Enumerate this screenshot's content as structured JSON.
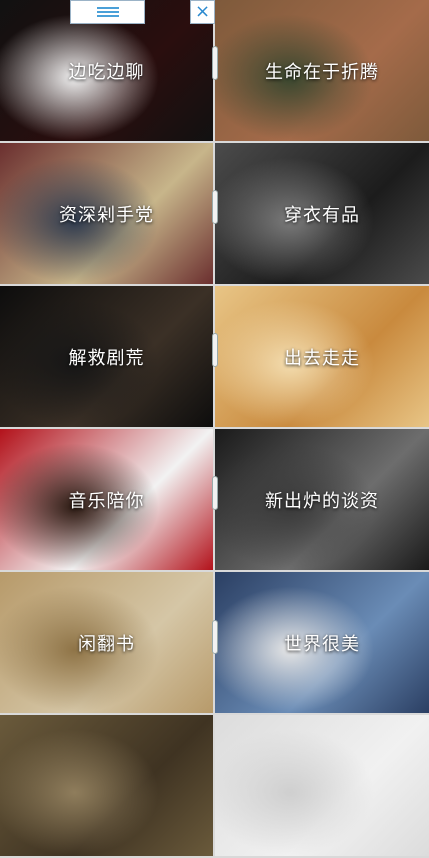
{
  "tiles": [
    {
      "label": "边吃边聊",
      "colors": [
        "#111111",
        "#2a0e0e",
        "#f0f0f0"
      ]
    },
    {
      "label": "生命在于折腾",
      "colors": [
        "#7e5a3b",
        "#a56b4a",
        "#39472f"
      ]
    },
    {
      "label": "资深剁手党",
      "colors": [
        "#6b2f2f",
        "#c7b58a",
        "#2e3b4f"
      ]
    },
    {
      "label": "穿衣有品",
      "colors": [
        "#4b4b4b",
        "#1c1c1c",
        "#7a7a7a"
      ]
    },
    {
      "label": "解救剧荒",
      "colors": [
        "#0d0d0d",
        "#3b3026",
        "#161616"
      ]
    },
    {
      "label": "出去走走",
      "colors": [
        "#e8c586",
        "#c98a3e",
        "#f3dcae"
      ]
    },
    {
      "label": "音乐陪你",
      "colors": [
        "#b3121b",
        "#f2f2f2",
        "#2b1a12"
      ]
    },
    {
      "label": "新出炉的谈资",
      "colors": [
        "#1a1a1a",
        "#6d6d6d",
        "#3a3a3a"
      ]
    },
    {
      "label": "闲翻书",
      "colors": [
        "#b79a6a",
        "#d5c6a6",
        "#8f7447"
      ]
    },
    {
      "label": "世界很美",
      "colors": [
        "#2b3f63",
        "#6a8cb6",
        "#e6e6e6"
      ]
    },
    {
      "label": "",
      "colors": [
        "#6a5a3b",
        "#3f3322",
        "#8f7d5c"
      ]
    },
    {
      "label": "",
      "colors": [
        "#dcdcdc",
        "#f1f1f1",
        "#cfcfcf"
      ]
    }
  ],
  "accent": "#4aa0d8"
}
